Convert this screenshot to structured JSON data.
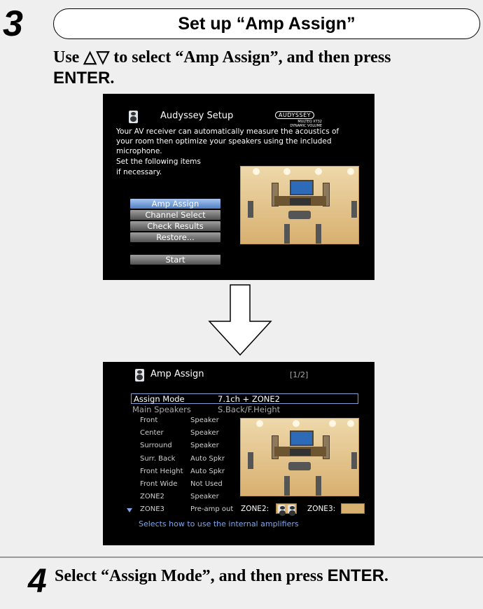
{
  "step3": {
    "number": "3",
    "title": "Set up “Amp Assign”",
    "instruction_line1": "Use △▽ to select “Amp Assign”, and then press",
    "instruction_key": "ENTER",
    "instruction_end": "."
  },
  "screen1": {
    "title": "Audyssey Setup",
    "logo_line1": "AUDYSSEY",
    "logo_line2": "MULTEQ XT32",
    "logo_line3": "DYNAMIC VOLUME",
    "description": [
      "Your AV receiver can automatically measure the acoustics of",
      "your room then optimize your speakers using the included",
      "microphone.",
      "Set the following items",
      "if necessary."
    ],
    "menu": [
      "Amp Assign",
      "Channel Select",
      "Check Results",
      "Restore..."
    ],
    "start_label": "Start"
  },
  "screen2": {
    "title": "Amp Assign",
    "page": "[1/2]",
    "assign_mode_label": "Assign Mode",
    "assign_mode_value": "7.1ch + ZONE2",
    "main_speakers_label": "Main Speakers",
    "main_speakers_value": "S.Back/F.Height",
    "rows": [
      {
        "name": "Front",
        "value": "Speaker"
      },
      {
        "name": "Center",
        "value": "Speaker"
      },
      {
        "name": "Surround",
        "value": "Speaker"
      },
      {
        "name": "Surr. Back",
        "value": "Auto Spkr"
      },
      {
        "name": "Front Height",
        "value": "Auto Spkr"
      },
      {
        "name": "Front Wide",
        "value": "Not Used"
      },
      {
        "name": "ZONE2",
        "value": "Speaker"
      },
      {
        "name": "ZONE3",
        "value": "Pre-amp out"
      }
    ],
    "zone2_label": "ZONE2:",
    "zone3_label": "ZONE3:",
    "footer": "Selects how to use the internal amplifiers"
  },
  "step4": {
    "number": "4",
    "instruction": "Select “Assign Mode”, and then press",
    "instruction_key": "ENTER",
    "instruction_end": "."
  }
}
